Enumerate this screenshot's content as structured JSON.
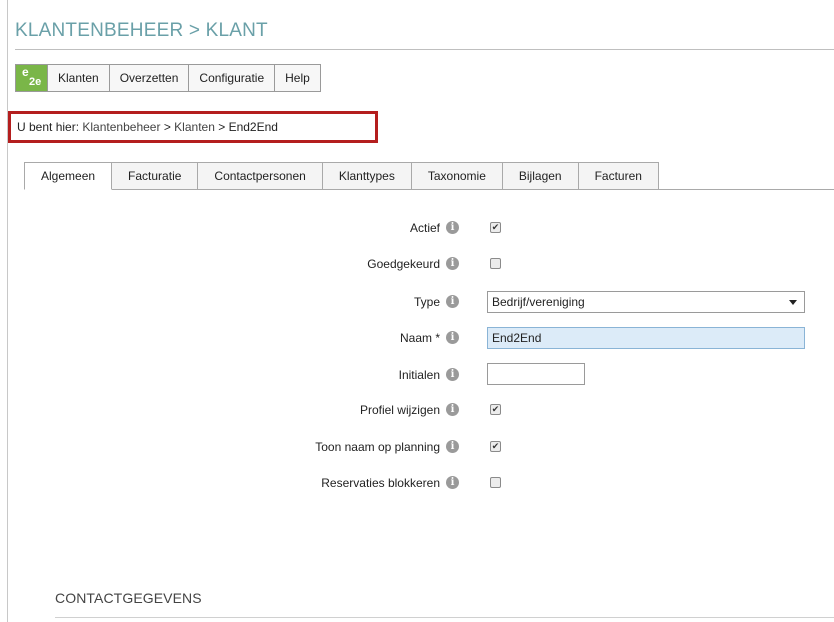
{
  "page": {
    "title": "KLANTENBEHEER > KLANT"
  },
  "menu": {
    "logo_top": "e",
    "logo_bottom": "2e",
    "items": [
      "Klanten",
      "Overzetten",
      "Configuratie",
      "Help"
    ]
  },
  "breadcrumb": {
    "prefix": "U bent hier:",
    "path": [
      "Klantenbeheer",
      "Klanten",
      "End2End"
    ],
    "separator": ">"
  },
  "tabs": [
    "Algemeen",
    "Facturatie",
    "Contactpersonen",
    "Klanttypes",
    "Taxonomie",
    "Bijlagen",
    "Facturen"
  ],
  "active_tab": "Algemeen",
  "form": {
    "actief": {
      "label": "Actief",
      "checked": true
    },
    "goedgekeurd": {
      "label": "Goedgekeurd",
      "checked": false
    },
    "type": {
      "label": "Type",
      "value": "Bedrijf/vereniging"
    },
    "naam": {
      "label": "Naam *",
      "value": "End2End"
    },
    "initialen": {
      "label": "Initialen",
      "value": ""
    },
    "profiel_wijzigen": {
      "label": "Profiel wijzigen",
      "checked": true
    },
    "toon_naam": {
      "label": "Toon naam op planning",
      "checked": true
    },
    "reservaties_blokkeren": {
      "label": "Reservaties blokkeren",
      "checked": false
    }
  },
  "icons": {
    "info": "i",
    "check": "✔"
  },
  "section": {
    "title": "CONTACTGEGEVENS"
  },
  "colors": {
    "accent_title": "#6aa0a8",
    "breadcrumb_border": "#b41e1e",
    "input_highlight": "#dcebf8"
  }
}
